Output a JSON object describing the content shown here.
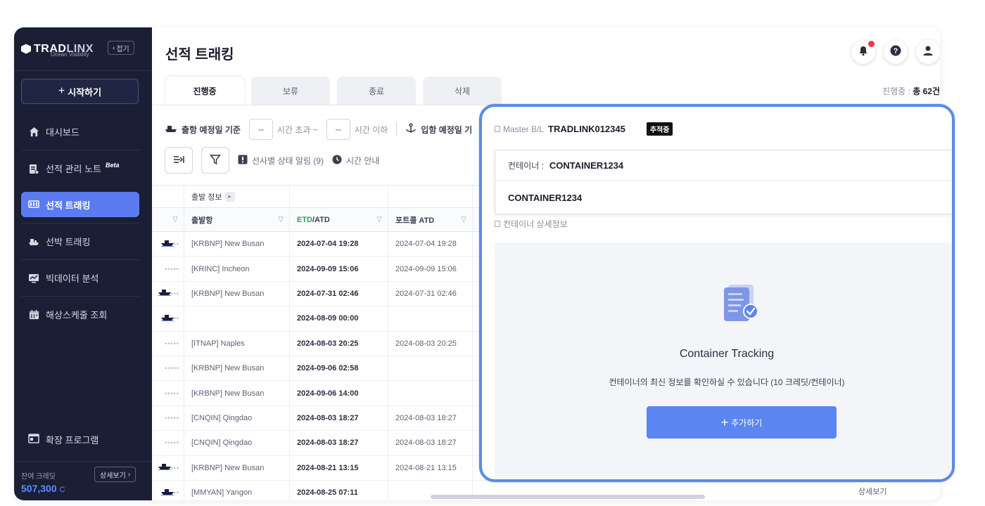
{
  "sidebar": {
    "logo_brand": "TRAD",
    "logo_brand2": "LINX",
    "logo_sub": "Ocean Visibility",
    "collapse_label": "접기",
    "start_label": "시작하기",
    "items": [
      {
        "label": "대시보드",
        "icon": "home-icon"
      },
      {
        "label": "선적 관리 노트",
        "badge": "Beta",
        "icon": "note-icon"
      },
      {
        "label": "선적 트래킹",
        "icon": "tracking-icon",
        "active": true
      },
      {
        "label": "선박 트래킹",
        "icon": "ship-icon"
      },
      {
        "label": "빅데이터 분석",
        "icon": "chart-icon"
      },
      {
        "label": "해상스케줄 조회",
        "icon": "calendar-icon"
      }
    ],
    "extension_label": "확장 프로그램",
    "credit_label": "잔여 크레딧",
    "credit_value": "507,300",
    "credit_unit": "C",
    "detail_label": "상세보기"
  },
  "header": {
    "title": "선적 트래킹"
  },
  "tabs": [
    {
      "label": "진행중",
      "active": true
    },
    {
      "label": "보류"
    },
    {
      "label": "종료"
    },
    {
      "label": "삭제"
    }
  ],
  "count": {
    "prefix": "진행중 :",
    "value": "총 62건"
  },
  "filters": {
    "departure_label": "출항 예정일 기준",
    "dash1": "--",
    "over_label": "시간 초과 ~",
    "dash2": "--",
    "under_label": "시간 이하",
    "arrival_label": "입항 예정일 기"
  },
  "toolbar": {
    "carrier_alert": "선사별 상태 알림 (9)",
    "time_guide": "시간 안내"
  },
  "table": {
    "group_header": "출발 정보",
    "columns": [
      "출발항",
      "ETD",
      "/ATD",
      "포트콜 ATD"
    ],
    "rows": [
      {
        "port": "[KRBNP] New Busan",
        "etd": "2024-07-04 19:28",
        "atd": "2024-07-04 19:28",
        "status": "ship"
      },
      {
        "port": "[KRINC] Incheon",
        "etd": "2024-09-09 15:06",
        "atd": "2024-09-09 15:06",
        "status": "dots"
      },
      {
        "port": "[KRBNP] New Busan",
        "etd": "2024-07-31 02:46",
        "atd": "2024-07-31 02:46",
        "status": "ship-dots"
      },
      {
        "port": "",
        "etd": "2024-08-09 00:00",
        "atd": "",
        "status": "ship"
      },
      {
        "port": "[ITNAP] Naples",
        "etd": "2024-08-03 20:25",
        "atd": "2024-08-03 20:25",
        "status": "dots"
      },
      {
        "port": "[KRBNP] New Busan",
        "etd": "2024-09-06 02:58",
        "atd": "",
        "status": "dots"
      },
      {
        "port": "[KRBNP] New Busan",
        "etd": "2024-09-06 14:00",
        "atd": "",
        "status": "dots"
      },
      {
        "port": "[CNQIN] Qingdao",
        "etd": "2024-08-03 18:27",
        "atd": "2024-08-03 18:27",
        "status": "dots"
      },
      {
        "port": "[CNQIN] Qingdao",
        "etd": "2024-08-03 18:27",
        "atd": "2024-08-03 18:27",
        "status": "dots"
      },
      {
        "port": "[KRBNP] New Busan",
        "etd": "2024-08-21 13:15",
        "atd": "2024-08-21 13:15",
        "status": "ship-dots"
      },
      {
        "port": "[MMYAN] Yangon",
        "etd": "2024-08-25 07:11",
        "atd": "",
        "status": "ship"
      }
    ],
    "ghost_text": "상세보기"
  },
  "popup": {
    "master_label": "Master B/L",
    "master_value": "TRADLINK012345",
    "status_badge": "추적중",
    "container_key": "컨테이너 :",
    "container_selected": "CONTAINER1234",
    "container_option": "CONTAINER1234",
    "info_label": "컨테이너 상세정보",
    "empty_title": "Container Tracking",
    "empty_sub": "컨테이너의 최신 정보를 확인하실 수 있습니다 (10 크레딧/컨테이너)",
    "add_label": "추가하기"
  },
  "colors": {
    "accent": "#5b85f0",
    "sidebar_bg": "#1a1f36",
    "popup_border": "#5b8be6",
    "notification": "#ec3b48"
  }
}
